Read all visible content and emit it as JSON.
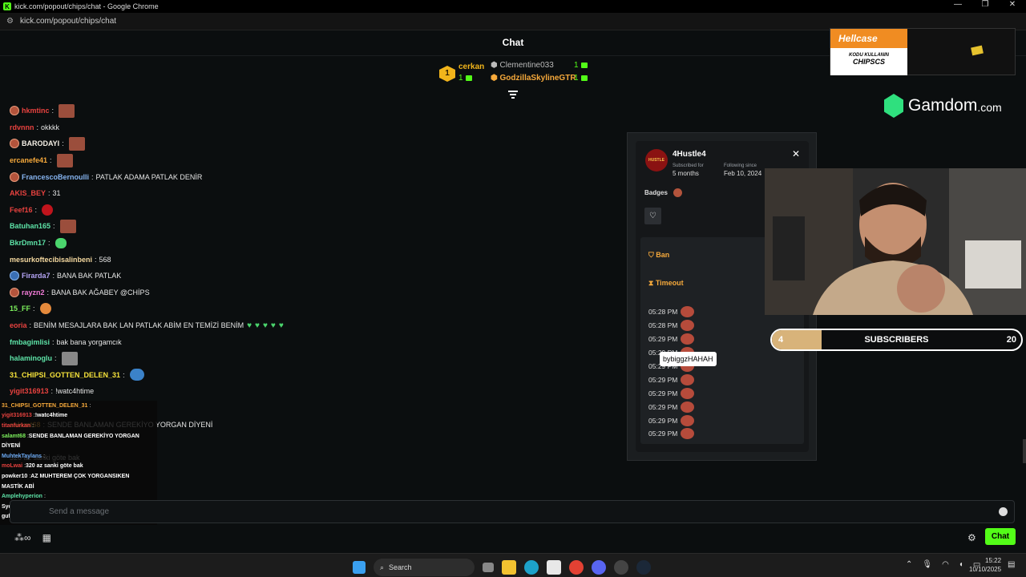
{
  "window": {
    "title": "kick.com/popout/chips/chat - Google Chrome",
    "url": "kick.com/popout/chips/chat"
  },
  "chat": {
    "title": "Chat",
    "input_placeholder": "Send a message",
    "send_label": "Chat"
  },
  "leaderboard": {
    "rank1": {
      "rank": "1",
      "name": "cerkan",
      "count": "1"
    },
    "rank2": {
      "name": "Clementine033",
      "count": "1"
    },
    "rank3": {
      "name": "GodzillaSkylineGTR",
      "count": "1"
    }
  },
  "messages": [
    {
      "user": "hkmtinc",
      "color": "#e8423f",
      "text": "",
      "badge": "orange",
      "emote": "brown"
    },
    {
      "user": "rdvnnn",
      "color": "#e8423f",
      "text": "okkkk",
      "badge": "",
      "emote": ""
    },
    {
      "user": "BARODAYI",
      "color": "#f5f0e6",
      "text": "",
      "badge": "orange",
      "emote": "brown"
    },
    {
      "user": "ercanefe41",
      "color": "#f6a93b",
      "text": "",
      "badge": "",
      "emote": "brown"
    },
    {
      "user": "FrancescoBernoulli",
      "color": "#86b4f0",
      "text": "PATLAK ADAMA PATLAK DENİR",
      "badge": "orange",
      "emote": ""
    },
    {
      "user": "AKIS_BEY",
      "color": "#e8423f",
      "text": "31",
      "badge": "",
      "emote": ""
    },
    {
      "user": "Feef16",
      "color": "#e8423f",
      "text": "",
      "badge": "",
      "emote": "red"
    },
    {
      "user": "Batuhan165",
      "color": "#5ee4a8",
      "text": "",
      "badge": "",
      "emote": "brown"
    },
    {
      "user": "BkrDmn17",
      "color": "#5ee4a8",
      "text": "",
      "badge": "",
      "emote": "green"
    },
    {
      "user": "mesurkoftecibisalinbeni",
      "color": "#f5d9a0",
      "text": "568",
      "badge": "",
      "emote": ""
    },
    {
      "user": "Firarda7",
      "color": "#b4a4f5",
      "text": "BANA BAK PATLAK",
      "badge": "blue",
      "emote": ""
    },
    {
      "user": "rayzn2",
      "color": "#f07ad6",
      "text": "BANA BAK AĞABEY @CHİPS",
      "badge": "orange",
      "emote": ""
    },
    {
      "user": "15_FF",
      "color": "#7cf05c",
      "text": "",
      "badge": "",
      "emote": "orange"
    },
    {
      "user": "eoria",
      "color": "#e8423f",
      "text": "BENİM MESAJLARA BAK LAN PATLAK ABİM EN TEMİZİ BENİM",
      "badge": "",
      "emote": "hearts"
    },
    {
      "user": "fmbagimlisi",
      "color": "#5ee4a8",
      "text": "bak bana yorgamcık",
      "badge": "",
      "emote": ""
    },
    {
      "user": "halaminoglu",
      "color": "#5ee4a8",
      "text": "",
      "badge": "",
      "emote": "gray"
    },
    {
      "user": "31_CHIPSI_GOTTEN_DELEN_31",
      "color": "#f6e23b",
      "text": "",
      "badge": "",
      "emote": "blue"
    },
    {
      "user": "yigit316913",
      "color": "#e8423f",
      "text": "!watc4htime",
      "badge": "",
      "emote": ""
    },
    {
      "user": "",
      "color": "#e6e6e6",
      "text": "",
      "badge": "",
      "emote": ""
    },
    {
      "user": "salamt68",
      "color": "#f6a93b",
      "text": "SENDE BANLAMAN GEREKİYO YORGAN DİYENİ",
      "badge": "",
      "emote": ""
    },
    {
      "user": "",
      "color": "#e6e6e6",
      "text": "",
      "badge": "",
      "emote": ""
    },
    {
      "user": "",
      "color": "#e6e6e6",
      "text": "320 az sanki göte bak",
      "badge": "",
      "emote": ""
    }
  ],
  "overlay_chat": [
    {
      "user": "31_CHIPSI_GOTTEN_DELEN_31",
      "color": "#f6a93b",
      "text": ""
    },
    {
      "user": "yigit316913",
      "color": "#e8423f",
      "text": "!watc4htime"
    },
    {
      "user": "titanfurkan",
      "color": "#e8423f",
      "text": ""
    },
    {
      "user": "salamt68",
      "color": "#7cf05c",
      "text": "SENDE BANLAMAN GEREKİYO YORGAN"
    },
    {
      "user": "",
      "color": "#fff",
      "text": "DİYENİ"
    },
    {
      "user": "MuhtekTaylans",
      "color": "#6aa7f0",
      "text": ""
    },
    {
      "user": "moLwai",
      "color": "#e8423f",
      "text": "320 az sanki göte bak"
    },
    {
      "user": "powker10",
      "color": "#fff",
      "text": "AZ MUHTEREM ÇOK YORGANSIKEN"
    },
    {
      "user": "",
      "color": "#fff",
      "text": "MASTİK ABİ"
    },
    {
      "user": "Amplehyperion",
      "color": "#5ee4a8",
      "text": ""
    },
    {
      "user": "SycTwelve",
      "color": "#fff",
      "text": ""
    },
    {
      "user": "gufranze",
      "color": "#fff",
      "text": ""
    }
  ],
  "user_card": {
    "username": "4Hustle4",
    "avatar_text": "HUSTLE",
    "subscribed_label": "Subscribed for",
    "subscribed_value": "5 months",
    "following_label": "Following since",
    "following_value": "Feb 10, 2024",
    "badges_label": "Badges",
    "ban_label": "Ban",
    "timeout_label": "Timeout",
    "history": [
      "05:28 PM",
      "05:28 PM",
      "05:29 PM",
      "05:29 PM",
      "05:29 PM",
      "05:29 PM",
      "05:29 PM",
      "05:29 PM",
      "05:29 PM",
      "05:29 PM"
    ],
    "tooltip": "bybiggzHAHAH"
  },
  "sponsors": {
    "hellcase_name": "Hellcase",
    "hellcase_line1": "KODU KULLANIN",
    "hellcase_code": "CHIPSCS",
    "gamdom_name": "Gamdom",
    "gamdom_suffix": ".com"
  },
  "subgoal": {
    "current": "4",
    "target": "20",
    "label": "SUBSCRIBERS",
    "progress": 0.2
  },
  "taskbar": {
    "search": "Search",
    "time": "15:22",
    "date": "10/10/2025"
  }
}
